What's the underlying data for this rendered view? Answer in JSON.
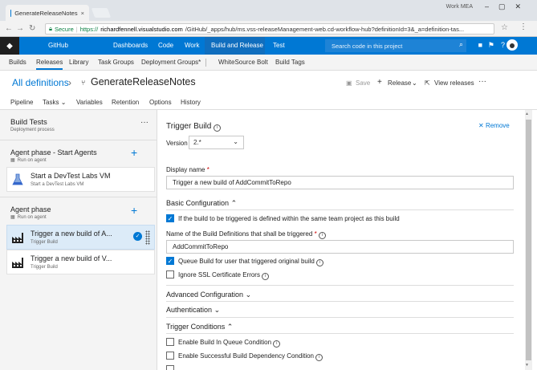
{
  "browser": {
    "tab_title": "GenerateReleaseNotes",
    "tab_close": "×",
    "win_user": "Work MEA",
    "secure_label": "Secure",
    "url_secure": "https://",
    "url_host": "richardfennell.visualstudio.com",
    "url_path": "/GitHub/_apps/hub/ms.vss-releaseManagement-web.cd-workflow-hub?definitionId=3&_a=definition-tas..."
  },
  "topnav": {
    "project": "GitHub",
    "items": [
      "Dashboards",
      "Code",
      "Work",
      "Build and Release",
      "Test"
    ],
    "search_placeholder": "Search code in this project"
  },
  "subnav": {
    "items": [
      "Builds",
      "Releases",
      "Library",
      "Task Groups",
      "Deployment Groups*",
      "WhiteSource Bolt",
      "Build Tags"
    ]
  },
  "breadcrumb": {
    "all": "All definitions",
    "sep": "›",
    "name": "GenerateReleaseNotes"
  },
  "actions": {
    "save": "Save",
    "release": "Release",
    "view_releases": "View releases",
    "more": "···"
  },
  "page_tabs": [
    "Pipeline",
    "Tasks",
    "Variables",
    "Retention",
    "Options",
    "History"
  ],
  "left": {
    "title": "Build Tests",
    "subtitle": "Deployment process",
    "phase1": {
      "title": "Agent phase - Start Agents",
      "sub": "Run on agent"
    },
    "task1": {
      "title": "Start a DevTest Labs VM",
      "sub": "Start a DevTest Labs VM"
    },
    "phase2": {
      "title": "Agent phase",
      "sub": "Run on agent"
    },
    "task2": {
      "title": "Trigger a new build of A...",
      "sub": "Trigger Build"
    },
    "task3": {
      "title": "Trigger a new build of V...",
      "sub": "Trigger Build"
    }
  },
  "right": {
    "title": "Trigger Build",
    "remove": "Remove",
    "version_label": "Version",
    "version_value": "2.*",
    "display_name_label": "Display name",
    "display_name_value": "Trigger a new build of AddCommitToRepo",
    "basic_config": "Basic Configuration",
    "cb1": "If the build to be triggered is defined within the same team project as this build",
    "build_def_label": "Name of the Build Definitions that shall be triggered",
    "build_def_value": "AddCommitToRepo",
    "cb2": "Queue Build for user that triggered original build",
    "cb3": "Ignore SSL Certificate Errors",
    "advanced_config": "Advanced Configuration",
    "authentication": "Authentication",
    "trigger_conditions": "Trigger Conditions",
    "cb4": "Enable Build In Queue Condition",
    "cb5": "Enable Successful Build Dependency Condition"
  }
}
